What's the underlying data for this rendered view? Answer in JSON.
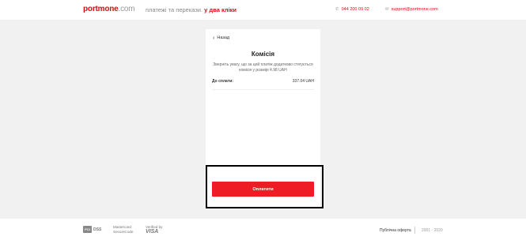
{
  "header": {
    "logo_brand": "portmone",
    "logo_domain": ".com",
    "tagline_main": "платежі та перекази.",
    "tagline_accent": "у два кліки",
    "phone": "044 200 09 02",
    "email": "support@portmone.com",
    "phone_icon": "phone-icon",
    "email_icon": "mail-icon"
  },
  "card": {
    "back_label": "Назад",
    "title": "Комісія",
    "note": "Зверніть увагу, що за цей платіж додатково стягується комісія у розмірі 4.98 UAH",
    "total_label": "До сплати:",
    "total_value": "337.04 UAH",
    "pay_button": "Оплатити"
  },
  "footer": {
    "pci_text": "DSS",
    "pci_box": "PCI",
    "mastercard_line1": "Mastercard",
    "mastercard_line2": "SecureCode",
    "visa_line1": "Verified by",
    "visa_line2": "VISA",
    "offer_link": "Публічна оферта",
    "years": "2001 - 2020"
  },
  "colors": {
    "accent": "#e30613",
    "button": "#ee1c25",
    "background": "#f1f1f1"
  }
}
